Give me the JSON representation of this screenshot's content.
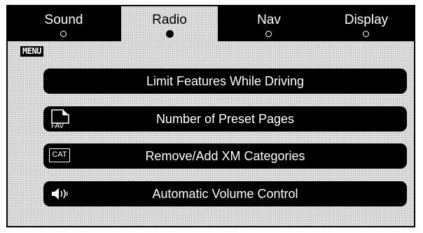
{
  "tabs": [
    {
      "label": "Sound",
      "active": false
    },
    {
      "label": "Radio",
      "active": true
    },
    {
      "label": "Nav",
      "active": false
    },
    {
      "label": "Display",
      "active": false
    }
  ],
  "menu_badge": "MENU",
  "buttons": [
    {
      "label": "Limit Features While Driving",
      "icon": null
    },
    {
      "label": "Number of Preset Pages",
      "icon": "fav-page-icon",
      "icon_text": "FAV"
    },
    {
      "label": "Remove/Add XM Categories",
      "icon": "cat-icon",
      "icon_text": "CAT"
    },
    {
      "label": "Automatic Volume Control",
      "icon": "speaker-volume-icon"
    }
  ],
  "colors": {
    "button_bg": "#000000",
    "screen_bg": "#e2e2e2",
    "text_light": "#ffffff"
  }
}
